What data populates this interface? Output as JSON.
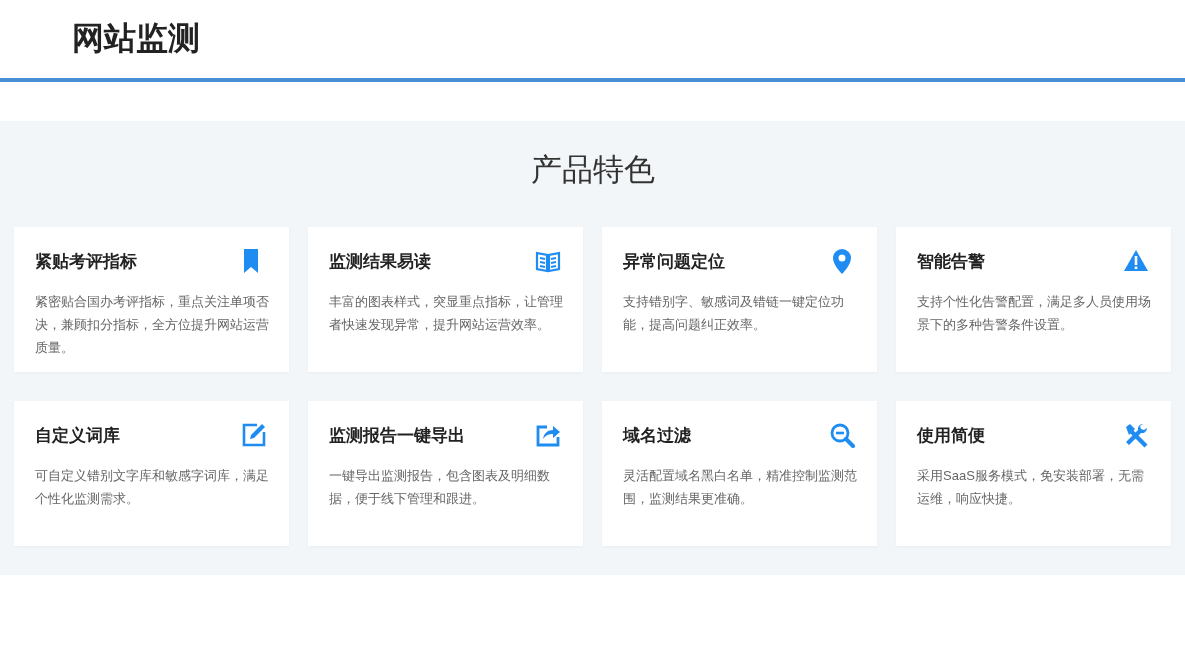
{
  "header": {
    "title": "网站监测"
  },
  "features": {
    "title": "产品特色",
    "cards": [
      {
        "title": "紧贴考评指标",
        "description": "紧密贴合国办考评指标，重点关注单项否决，兼顾扣分指标，全方位提升网站运营质量。"
      },
      {
        "title": "监测结果易读",
        "description": "丰富的图表样式，突显重点指标，让管理者快速发现异常，提升网站运营效率。"
      },
      {
        "title": "异常问题定位",
        "description": "支持错别字、敏感词及错链一键定位功能，提高问题纠正效率。"
      },
      {
        "title": "智能告警",
        "description": "支持个性化告警配置，满足多人员使用场景下的多种告警条件设置。"
      },
      {
        "title": "自定义词库",
        "description": "可自定义错别文字库和敏感字词库，满足个性化监测需求。"
      },
      {
        "title": "监测报告一键导出",
        "description": "一键导出监测报告，包含图表及明细数据，便于线下管理和跟进。"
      },
      {
        "title": "域名过滤",
        "description": "灵活配置域名黑白名单，精准控制监测范围，监测结果更准确。"
      },
      {
        "title": "使用简便",
        "description": "采用SaaS服务模式，免安装部署，无需运维，响应快捷。"
      }
    ]
  }
}
